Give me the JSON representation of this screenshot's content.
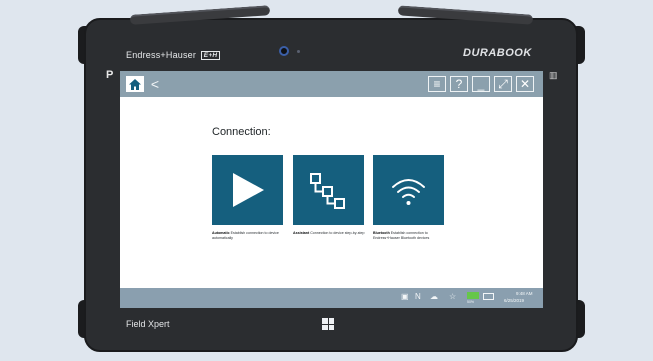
{
  "device": {
    "brand_left": "Endress+Hauser",
    "brand_left_mark": "E+H",
    "brand_right": "DURABOOK",
    "physical_key": "P",
    "side_icon": "▥",
    "bottom_label": "Field Xpert"
  },
  "titlebar": {
    "home_icon": "home-icon",
    "back_glyph": "<",
    "buttons": [
      {
        "name": "menu-icon",
        "glyph": "≡"
      },
      {
        "name": "help-icon",
        "glyph": "?"
      },
      {
        "name": "minimize-icon",
        "glyph": "_"
      },
      {
        "name": "fullscreen-icon",
        "glyph": "⤢"
      },
      {
        "name": "close-icon",
        "glyph": "✕"
      }
    ]
  },
  "main": {
    "heading": "Connection:",
    "cards": [
      {
        "icon": "play-icon",
        "title": "Automatic",
        "description": "Establish connection to device automatically"
      },
      {
        "icon": "hierarchy-icon",
        "title": "Assistant",
        "description": "Connection to device step-by-step"
      },
      {
        "icon": "wifi-icon",
        "title": "Bluetooth",
        "description": "Establish connection to Endress+Hauser Bluetooth devices"
      }
    ]
  },
  "taskbar": {
    "tray": [
      "▣",
      "N",
      "☁",
      "☆"
    ],
    "battery": "50%",
    "time": "9:48 AM",
    "date": "6/25/2019"
  },
  "colors": {
    "accent": "#155f7e",
    "titlebar": "#8ba0ad",
    "taskbar": "#8a9faf",
    "bezel": "#2b2d30"
  }
}
